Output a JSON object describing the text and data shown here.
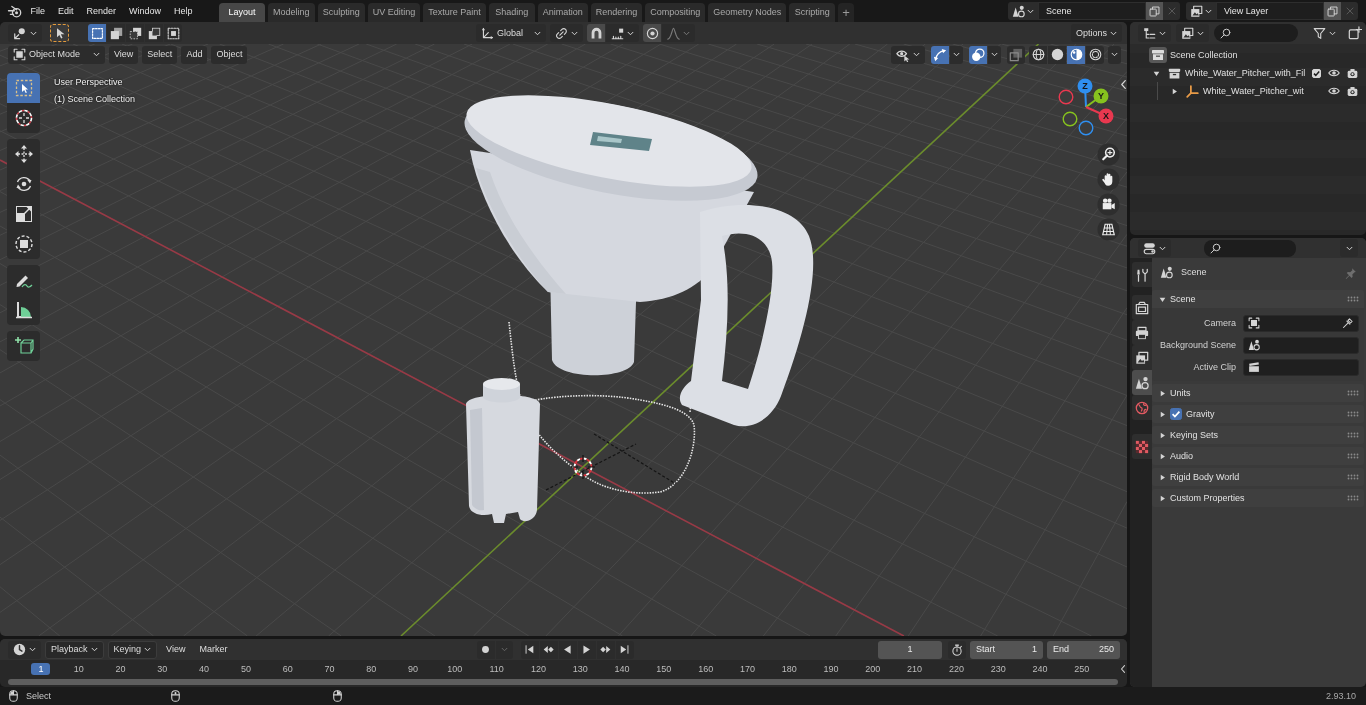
{
  "top_bar": {
    "menus": [
      "File",
      "Edit",
      "Render",
      "Window",
      "Help"
    ],
    "workspaces": [
      {
        "label": "Layout",
        "selected": true
      },
      {
        "label": "Modeling",
        "selected": false
      },
      {
        "label": "Sculpting",
        "selected": false
      },
      {
        "label": "UV Editing",
        "selected": false
      },
      {
        "label": "Texture Paint",
        "selected": false
      },
      {
        "label": "Shading",
        "selected": false
      },
      {
        "label": "Animation",
        "selected": false
      },
      {
        "label": "Rendering",
        "selected": false
      },
      {
        "label": "Compositing",
        "selected": false
      },
      {
        "label": "Geometry Nodes",
        "selected": false
      },
      {
        "label": "Scripting",
        "selected": false
      }
    ],
    "add_workspace": "+",
    "scene": "Scene",
    "view_layer": "View Layer"
  },
  "viewport": {
    "tool_settings": {
      "select_modes": [
        {
          "kind": "set",
          "selected": true
        },
        {
          "kind": "extend",
          "selected": false
        },
        {
          "kind": "subtract",
          "selected": false
        },
        {
          "kind": "invert",
          "selected": false
        },
        {
          "kind": "intersect",
          "selected": false
        }
      ],
      "orientation": "Global",
      "options": "Options"
    },
    "header": {
      "mode": "Object Mode",
      "menus": [
        "View",
        "Select",
        "Add",
        "Object"
      ],
      "toggles": [
        {
          "kind": "gizmos",
          "on": true
        },
        {
          "kind": "overlays",
          "on": true
        },
        {
          "kind": "xray",
          "on": false
        }
      ],
      "shading_modes": [
        {
          "kind": "wireframe",
          "selected": false
        },
        {
          "kind": "solid",
          "selected": false
        },
        {
          "kind": "material",
          "selected": true
        },
        {
          "kind": "rendered",
          "selected": false
        }
      ]
    },
    "overlay_text": [
      "User Perspective",
      "(1) Scene Collection"
    ],
    "tool_groups": [
      [
        {
          "kind": "select",
          "selected": true
        },
        {
          "kind": "cursor",
          "selected": false
        }
      ],
      [
        {
          "kind": "move",
          "selected": false
        },
        {
          "kind": "rotate",
          "selected": false
        },
        {
          "kind": "scale",
          "selected": false
        },
        {
          "kind": "transform",
          "selected": false
        }
      ],
      [
        {
          "kind": "annotate",
          "selected": false
        },
        {
          "kind": "measure",
          "selected": false
        }
      ],
      [
        {
          "kind": "add",
          "selected": false
        }
      ]
    ],
    "gizmo_axes": [
      "Z",
      "Y",
      "X"
    ]
  },
  "outliner": {
    "tree": [
      {
        "label": "Scene Collection",
        "kind": "scene_collection",
        "children": [
          {
            "label": "White_Water_Pitcher_with_Fil",
            "kind": "collection",
            "expanded": true,
            "checked": true,
            "children": [
              {
                "label": "White_Water_Pitcher_wit",
                "kind": "empty",
                "expanded": false
              }
            ]
          }
        ]
      }
    ]
  },
  "properties": {
    "tabs": [
      {
        "kind": "tool",
        "selected": false
      },
      {
        "kind": "render",
        "selected": false
      },
      {
        "kind": "output",
        "selected": false
      },
      {
        "kind": "view_layer",
        "selected": false
      },
      {
        "kind": "scene",
        "selected": true
      },
      {
        "kind": "world",
        "selected": false
      },
      {
        "kind": "texture",
        "selected": false
      }
    ],
    "context": "Scene",
    "panels": [
      {
        "title": "Scene",
        "expanded": true,
        "fields": [
          {
            "label": "Camera",
            "kind": "object"
          },
          {
            "label": "Background Scene",
            "kind": "scene"
          },
          {
            "label": "Active Clip",
            "kind": "clip"
          }
        ]
      },
      {
        "title": "Units",
        "expanded": false
      },
      {
        "title": "Gravity",
        "expanded": false,
        "checked": true
      },
      {
        "title": "Keying Sets",
        "expanded": false
      },
      {
        "title": "Audio",
        "expanded": false
      },
      {
        "title": "Rigid Body World",
        "expanded": false
      },
      {
        "title": "Custom Properties",
        "expanded": false
      }
    ]
  },
  "timeline": {
    "menus": [
      {
        "label": "Playback",
        "kind": "dropdown"
      },
      {
        "label": "Keying",
        "kind": "dropdown"
      },
      {
        "label": "View",
        "kind": "menu"
      },
      {
        "label": "Marker",
        "kind": "menu"
      }
    ],
    "current_frame": "1",
    "start": {
      "label": "Start",
      "value": "1"
    },
    "end": {
      "label": "End",
      "value": "250"
    },
    "frames": [
      {
        "label": "1",
        "selected": true
      },
      {
        "label": "10",
        "selected": false
      },
      {
        "label": "20",
        "selected": false
      },
      {
        "label": "30",
        "selected": false
      },
      {
        "label": "40",
        "selected": false
      },
      {
        "label": "50",
        "selected": false
      },
      {
        "label": "60",
        "selected": false
      },
      {
        "label": "70",
        "selected": false
      },
      {
        "label": "80",
        "selected": false
      },
      {
        "label": "90",
        "selected": false
      },
      {
        "label": "100",
        "selected": false
      },
      {
        "label": "110",
        "selected": false
      },
      {
        "label": "120",
        "selected": false
      },
      {
        "label": "130",
        "selected": false
      },
      {
        "label": "140",
        "selected": false
      },
      {
        "label": "150",
        "selected": false
      },
      {
        "label": "160",
        "selected": false
      },
      {
        "label": "170",
        "selected": false
      },
      {
        "label": "180",
        "selected": false
      },
      {
        "label": "190",
        "selected": false
      },
      {
        "label": "200",
        "selected": false
      },
      {
        "label": "210",
        "selected": false
      },
      {
        "label": "220",
        "selected": false
      },
      {
        "label": "230",
        "selected": false
      },
      {
        "label": "240",
        "selected": false
      },
      {
        "label": "250",
        "selected": false
      }
    ]
  },
  "status_bar": {
    "hint": "Select",
    "version": "2.93.10"
  }
}
